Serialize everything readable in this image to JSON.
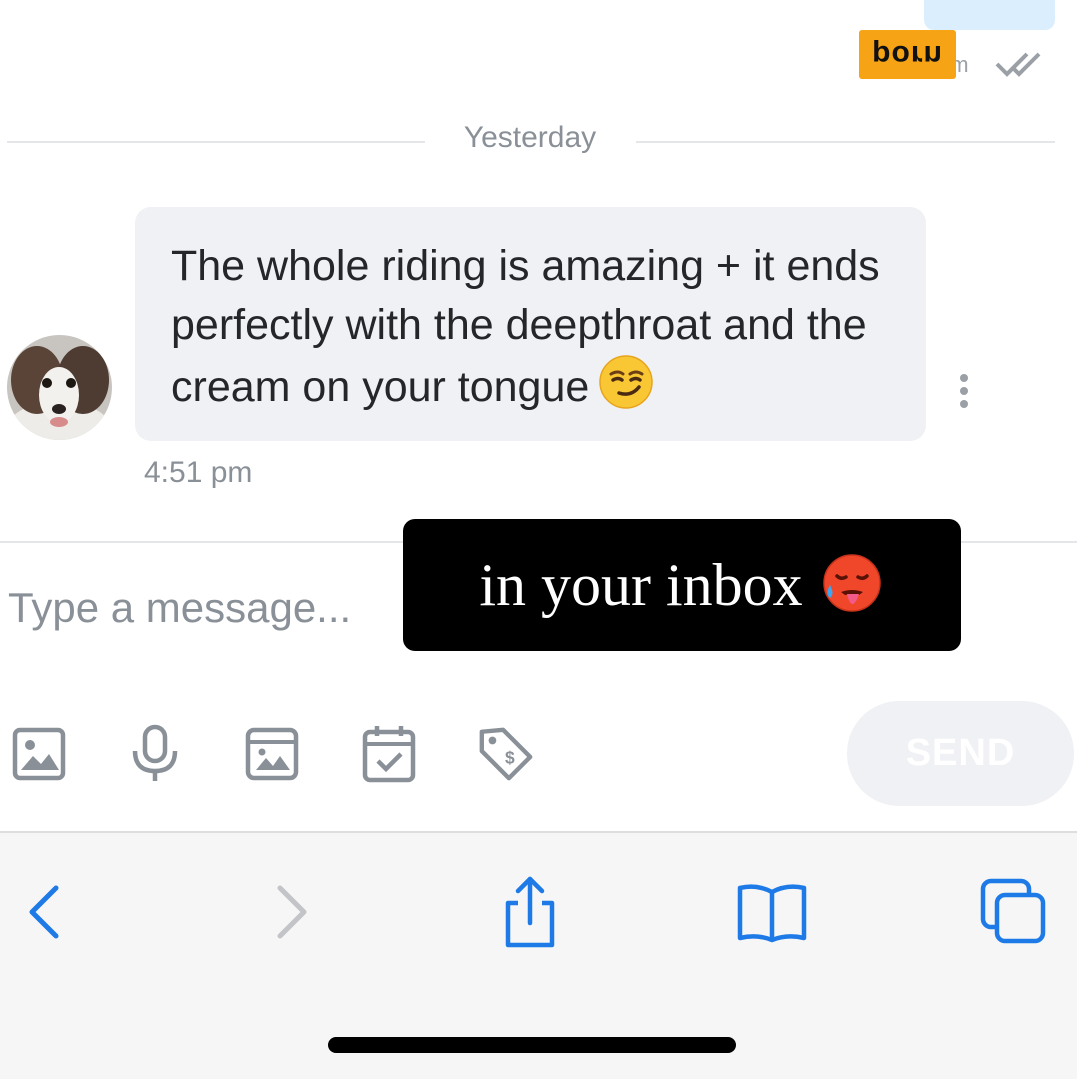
{
  "watermark": {
    "text": "porn"
  },
  "top_message": {
    "time": "pm"
  },
  "date_divider": {
    "label": "Yesterday"
  },
  "message": {
    "text": "The whole riding is amazing + it ends perfectly with the deepthroat and the cream on your tongue",
    "emoji": "smirking-face",
    "time": "4:51 pm"
  },
  "composer": {
    "placeholder": "Type a message...",
    "send_label": "SEND",
    "tools": [
      "image-icon",
      "microphone-icon",
      "media-vault-icon",
      "calendar-check-icon",
      "price-tag-icon"
    ]
  },
  "overlay": {
    "text": "in your inbox",
    "emoji": "hot-face"
  },
  "browser": {
    "buttons": [
      "back",
      "forward",
      "share",
      "bookmarks",
      "tabs"
    ]
  },
  "colors": {
    "accent": "#1e7ae6",
    "muted": "#8a9097",
    "bubble": "#f0f1f4",
    "watermark": "#f6a316"
  }
}
